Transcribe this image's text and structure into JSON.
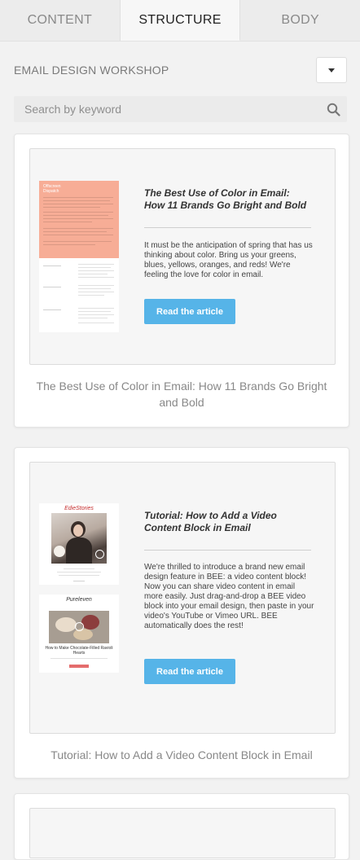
{
  "tabs": [
    {
      "label": "CONTENT",
      "active": false
    },
    {
      "label": "STRUCTURE",
      "active": true
    },
    {
      "label": "BODY",
      "active": false
    }
  ],
  "collection": {
    "title": "EMAIL DESIGN WORKSHOP"
  },
  "search": {
    "placeholder": "Search by keyword",
    "value": ""
  },
  "cards": [
    {
      "article_title": "The Best Use of Color in Email: How 11 Brands Go Bright and Bold",
      "article_body": "It must be the anticipation of spring that has us thinking about color. Bring us your greens, blues, yellows, oranges, and reds! We're feeling the love for color in email.",
      "button_label": "Read the article",
      "caption": "The Best Use of Color in Email: How 11 Brands Go Bright and Bold",
      "thumb_header": "Offscreen\nDispatch",
      "thumb_color": "#f7ad96"
    },
    {
      "article_title": "Tutorial: How to Add a Video Content Block in Email",
      "article_body": "We're thrilled to introduce a brand new email design feature in BEE: a video content block! Now you can share video content in email more easily. Just drag-and-drop a BEE video block into your email design, then paste in your video's YouTube or Vimeo URL. BEE automatically does the rest!",
      "button_label": "Read the article",
      "caption": "Tutorial: How to Add a Video Content Block in Email",
      "thumb_brand_1": "EdieStories",
      "thumb_brand_2": "Pureleven",
      "thumb_recipe": "How to Make Chocolate-Filled Ravioli Hearts"
    }
  ],
  "colors": {
    "accent": "#56b4e8",
    "background": "#f2f2f2",
    "card": "#ffffff"
  }
}
